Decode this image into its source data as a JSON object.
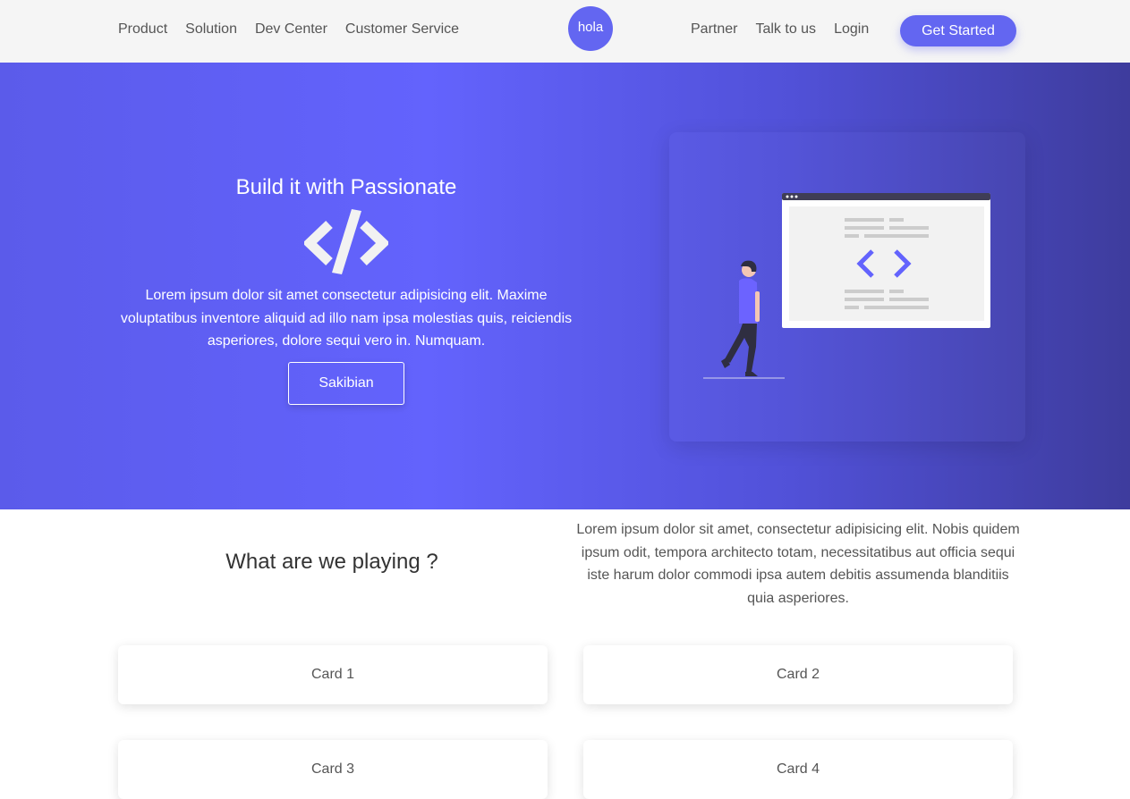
{
  "navbar": {
    "left_links": [
      "Product",
      "Solution",
      "Dev Center",
      "Customer Service"
    ],
    "logo_text": "hola",
    "right_links": [
      "Partner",
      "Talk to us",
      "Login"
    ],
    "cta_label": "Get Started"
  },
  "hero": {
    "title": "Build it with Passionate",
    "text": "Lorem ipsum dolor sit amet consectetur adipisicing elit. Maxime voluptatibus inventore aliquid ad illo nam ipsa molestias quis, reiciendis asperiores, dolore sequi vero in. Numquam.",
    "button_label": "Sakibian",
    "icon": "code-icon"
  },
  "section": {
    "title": "What are we playing ?",
    "text": "Lorem ipsum dolor sit amet, consectetur adipisicing elit. Nobis quidem ipsum odit, tempora architecto totam, necessitatibus aut officia sequi iste harum dolor commodi ipsa autem debitis assumenda blanditiis quia asperiores."
  },
  "cards": [
    "Card 1",
    "Card 2",
    "Card 3",
    "Card 4"
  ],
  "colors": {
    "accent": "#6366f1",
    "hero_dark": "#3e3c9d",
    "navbar_bg": "#f5f5f5"
  }
}
